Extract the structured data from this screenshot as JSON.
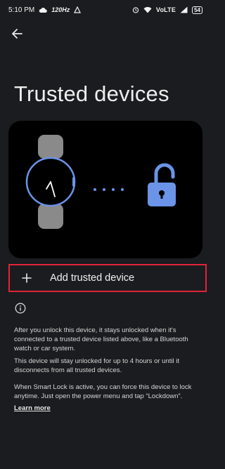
{
  "status_bar": {
    "time": "5:10 PM",
    "refresh_rate": "120Hz",
    "network": "VoLTE",
    "battery": "54"
  },
  "icons": {
    "back": "arrow-left-icon",
    "add": "plus-icon",
    "info": "info-icon",
    "watch": "watch-icon",
    "lock": "lock-open-icon"
  },
  "page": {
    "title": "Trusted devices"
  },
  "add_trusted_device": {
    "label": "Add trusted device"
  },
  "info": {
    "paragraph_1": "After you unlock this device, it stays unlocked when it's connected to a trusted device listed above, like a Bluetooth watch or car system.",
    "paragraph_2": "This device will stay unlocked for up to 4 hours or until it disconnects from all trusted devices.",
    "paragraph_3": "When Smart Lock is active, you can force this device to lock anytime. Just open the power menu and tap “Lockdown”.",
    "learn_more": "Learn more"
  },
  "colors": {
    "background": "#1b1c1f",
    "accent_blue": "#6b93e8",
    "watch_band": "#8a8a8a",
    "highlight_border": "#e0243a"
  }
}
